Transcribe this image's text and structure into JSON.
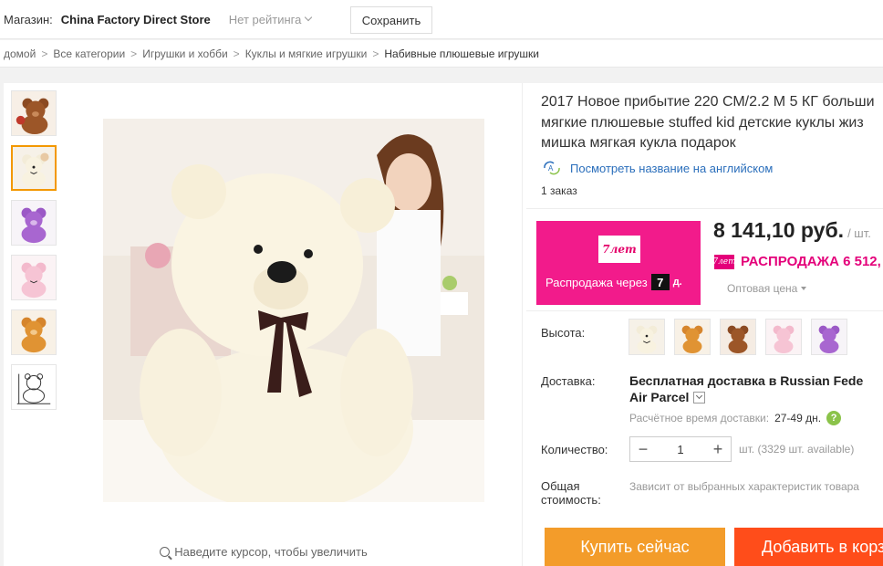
{
  "store": {
    "label": "Магазин:",
    "name": "China Factory Direct Store",
    "rating": "Нет рейтинга",
    "save_label": "Сохранить"
  },
  "breadcrumb": [
    "домой",
    "Все категории",
    "Игрушки и хобби",
    "Куклы и мягкие игрушки",
    "Набивные плюшевые игрушки"
  ],
  "gallery": {
    "zoom_hint": "Наведите курсор, чтобы увеличить",
    "thumbnails": [
      "brown-bear",
      "white-bear",
      "purple-bear",
      "pink-bear",
      "orange-bear",
      "sketch-bear"
    ],
    "active_index": 1
  },
  "product": {
    "title_lines": [
      "2017 Новое прибытие 220 СМ/2.2 М 5 КГ больши",
      "мягкие плюшевые stuffed kid детские куклы жиз",
      "мишка мягкая кукла подарок"
    ],
    "translate_link": "Посмотреть название на английском",
    "orders": "1 заказ"
  },
  "promo": {
    "badge": "7лет",
    "text": "Распродажа через",
    "days": "7",
    "days_unit": "д.",
    "color": "#f21b8b"
  },
  "pricing": {
    "price": "8 141,10 руб.",
    "unit": "/ шт.",
    "sale_badge": "7лет",
    "sale_text": "РАСПРОДАЖА 6 512,",
    "wholesale": "Оптовая цена"
  },
  "options": {
    "height_label": "Высота:",
    "swatches": [
      "white-bear",
      "orange-bear",
      "brown-bear",
      "pink-bear",
      "purple-bear"
    ]
  },
  "shipping": {
    "label": "Доставка:",
    "line1": "Бесплатная доставка в Russian Fede",
    "line2": "Air Parcel",
    "eta_label": "Расчётное время доставки:",
    "eta_days": "27-49 дн.",
    "help": "?"
  },
  "quantity": {
    "label": "Количество:",
    "value": "1",
    "minus": "−",
    "plus": "+",
    "available": "шт. (3329 шт. available)"
  },
  "total": {
    "label_line1": "Общая",
    "label_line2": "стоимость:",
    "note": "Зависит от выбранных характеристик товара"
  },
  "actions": {
    "buy_now": "Купить сейчас",
    "add_to_cart": "Добавить в корз"
  },
  "colors": {
    "buy_now": "#f39c2a",
    "add_to_cart": "#ff4d1a",
    "link": "#2a6ebb",
    "sale": "#e4007a"
  }
}
